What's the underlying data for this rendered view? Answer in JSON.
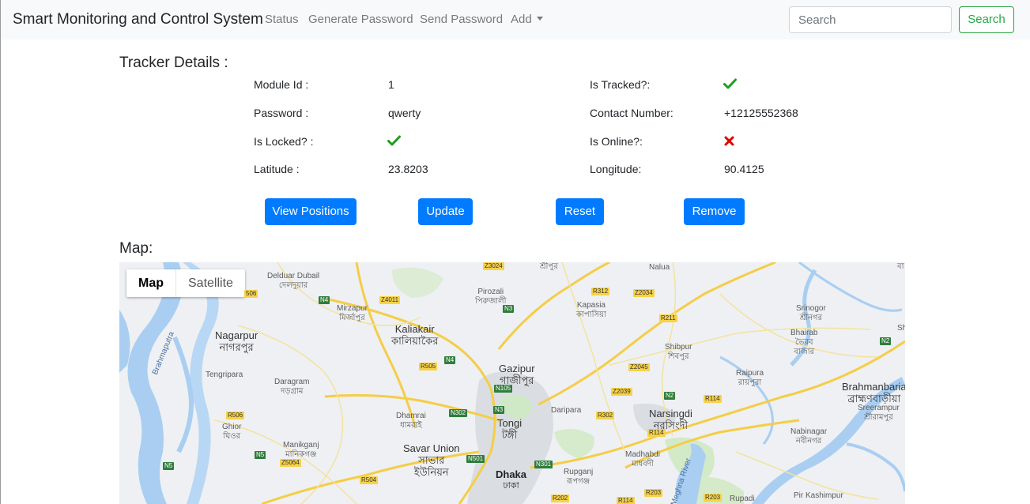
{
  "app": {
    "brand": "Smart Monitoring and Control System",
    "nav": [
      "Status",
      "Generate Password",
      "Send Password",
      "Add"
    ],
    "search": {
      "placeholder": "Search",
      "button": "Search"
    }
  },
  "colors": {
    "primary": "#007bff",
    "success": "#28a745",
    "check": "#1e9e1e",
    "cross": "#e00000"
  },
  "tracker": {
    "heading": "Tracker Details :",
    "module_id": {
      "label": "Module Id :",
      "value": "1"
    },
    "password": {
      "label": "Password :",
      "value": "qwerty"
    },
    "is_locked": {
      "label": "Is Locked? :",
      "icon": "check-icon"
    },
    "latitude": {
      "label": "Latitude :",
      "value": "23.8203"
    },
    "is_tracked": {
      "label": "Is Tracked?:",
      "icon": "check-icon"
    },
    "contact": {
      "label": "Contact Number:",
      "value": "+12125552368"
    },
    "is_online": {
      "label": "Is Online?:",
      "icon": "cross-icon"
    },
    "longitude": {
      "label": "Longitude:",
      "value": "90.4125"
    }
  },
  "actions": [
    "View Positions",
    "Update",
    "Reset",
    "Remove"
  ],
  "map": {
    "heading": "Map:",
    "toggle": {
      "map": "Map",
      "satellite": "Satellite"
    },
    "places": {
      "delduar": [
        "Delduar Dubail",
        "দেলদুয়ার"
      ],
      "mirzapur": [
        "Mirzapur",
        "মির্জাপুর"
      ],
      "pirozali": [
        "Pirozali",
        "পিরুজালী"
      ],
      "kapasia": [
        "Kapasia",
        "কাপাসিয়া"
      ],
      "nalua": [
        "Nalua"
      ],
      "srinogor": [
        "Srinogor",
        "শ্রীনগর"
      ],
      "bhairab": [
        "Bhairab",
        "ভৈরব",
        "বাজার"
      ],
      "nagarpur": [
        "Nagarpur",
        "নাগরপুর"
      ],
      "kaliakair": [
        "Kaliakair",
        "কালিয়াকৈর"
      ],
      "shibpur": [
        "Shibpur",
        "শিবপুর"
      ],
      "tengripara": [
        "Tengripara"
      ],
      "gazipur": [
        "Gazipur",
        "গাজীপুর"
      ],
      "raipura": [
        "Raipura",
        "রায়পুরা"
      ],
      "brahmanbaria": [
        "Brahmanbaria",
        "ব্রাহ্মণবাড়ীয়া"
      ],
      "daragram": [
        "Daragram",
        "দড়গ্রাম"
      ],
      "sreerampur": [
        "Sreerampur",
        "শ্রীরামপুর"
      ],
      "dhamrai": [
        "Dhamrai",
        "ধামরাই"
      ],
      "daripara": [
        "Daripara"
      ],
      "narsingdi": [
        "Narsingdi",
        "নরসিংদী"
      ],
      "ghior": [
        "Ghior",
        "ঘিওর"
      ],
      "tongi": [
        "Tongi",
        "টঙ্গী"
      ],
      "nabinagar": [
        "Nabinagar",
        "নবীনগর"
      ],
      "manikganj": [
        "Manikganj",
        "মানিকগঞ্জ"
      ],
      "savar": [
        "Savar Union",
        "সাভার",
        "ইউনিয়ন"
      ],
      "madhabdi": [
        "Madhabdi",
        "মাধবদী"
      ],
      "dhaka": [
        "Dhaka",
        "ঢাকা"
      ],
      "rupganj": [
        "Rupganj",
        "রূপগঞ্জ"
      ],
      "rupadi": [
        "Rupadi"
      ],
      "pir_kashimpur": [
        "Pir Kashimpur"
      ],
      "top_bangla": [
        "শ্রীপুর"
      ],
      "sh": [
        "Sh"
      ],
      "right_top": [
        "বা"
      ]
    },
    "rivers": [
      "Brahmaputra",
      "Meghna River"
    ],
    "roads": [
      "Z3024",
      "R312",
      "Z2034",
      "N4",
      "Z4011",
      "N3",
      "R211",
      "N2",
      "R505",
      "N4",
      "Z2045",
      "N105",
      "Z2039",
      "N2",
      "R114",
      "R506",
      "N302",
      "N3",
      "R302",
      "R114",
      "N5",
      "Z5064",
      "N501",
      "N301",
      "N5",
      "R504",
      "R202",
      "R114",
      "R203",
      "R203",
      "506"
    ]
  }
}
